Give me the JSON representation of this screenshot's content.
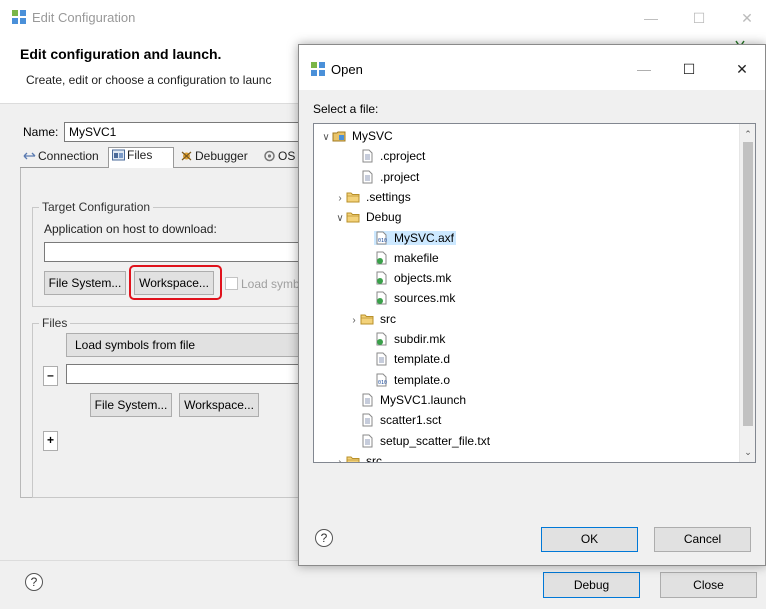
{
  "edit_window": {
    "title": "Edit Configuration",
    "header_title": "Edit configuration and launch.",
    "header_desc": "Create, edit or choose a configuration to launc",
    "name_label": "Name:",
    "name_value": "MySVC1",
    "tabs": [
      {
        "label": "Connection",
        "icon": "connection-icon"
      },
      {
        "label": "Files",
        "icon": "files-icon",
        "active": true
      },
      {
        "label": "Debugger",
        "icon": "debugger-icon"
      },
      {
        "label": "OS",
        "icon": "os-icon"
      }
    ],
    "target_group_label": "Target Configuration",
    "app_label": "Application on host to download:",
    "file_system_label": "File System...",
    "workspace_label": "Workspace...",
    "load_symbols_label": "Load symb",
    "files_group_label": "Files",
    "load_symbols_dropdown": "Load symbols from file",
    "remove_label": "–",
    "add_label": "+",
    "file_system_label_2": "File System...",
    "workspace_label_2": "Workspace...",
    "debug_label": "Debug",
    "close_label": "Close",
    "help_glyph": "?",
    "highlight_color": "#e0121c"
  },
  "open_dialog": {
    "title": "Open",
    "prompt": "Select a file:",
    "tree": [
      {
        "label": "MySVC",
        "icon": "project-icon",
        "twisty": "v"
      },
      {
        "label": ".cproject",
        "icon": "file-icon"
      },
      {
        "label": ".project",
        "icon": "file-icon"
      },
      {
        "label": ".settings",
        "icon": "folder-icon",
        "twisty": ">"
      },
      {
        "label": "Debug",
        "icon": "folder-icon",
        "twisty": "v"
      },
      {
        "label": "MySVC.axf",
        "icon": "binary-file-icon",
        "selected": true
      },
      {
        "label": "makefile",
        "icon": "make-file-icon"
      },
      {
        "label": "objects.mk",
        "icon": "make-file-icon"
      },
      {
        "label": "sources.mk",
        "icon": "make-file-icon"
      },
      {
        "label": "src",
        "icon": "folder-icon",
        "twisty": ">"
      },
      {
        "label": "subdir.mk",
        "icon": "make-file-icon"
      },
      {
        "label": "template.d",
        "icon": "file-icon"
      },
      {
        "label": "template.o",
        "icon": "binary-file-icon"
      },
      {
        "label": "MySVC1.launch",
        "icon": "file-icon"
      },
      {
        "label": "scatter1.sct",
        "icon": "file-icon"
      },
      {
        "label": "setup_scatter_file.txt",
        "icon": "file-icon"
      },
      {
        "label": "src",
        "icon": "folder-icon",
        "twisty": ">"
      }
    ],
    "ok_label": "OK",
    "cancel_label": "Cancel",
    "help_glyph": "?"
  }
}
